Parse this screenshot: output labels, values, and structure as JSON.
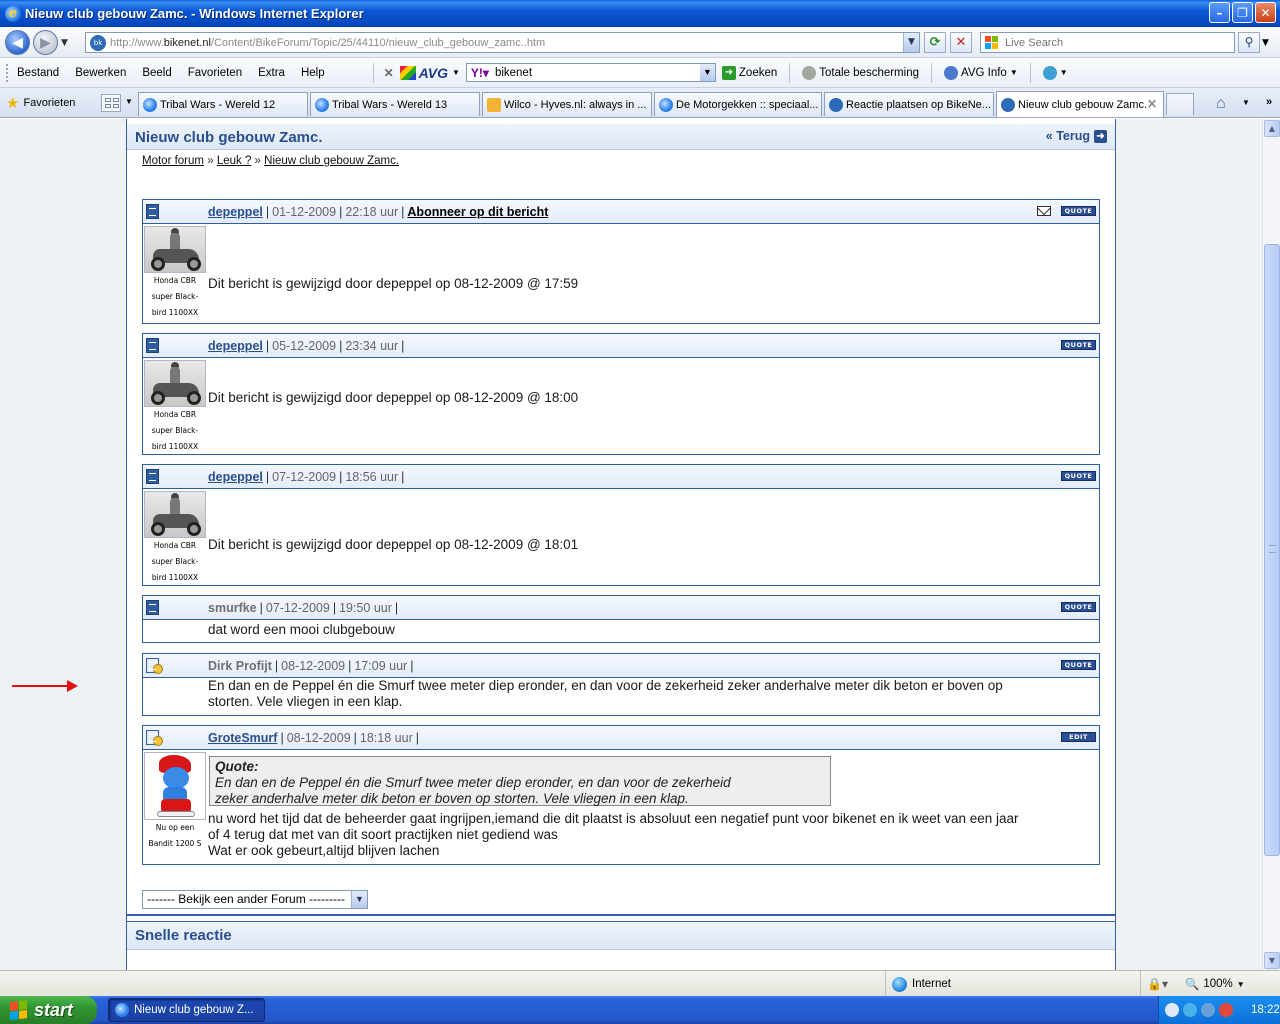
{
  "window": {
    "title": "Nieuw club gebouw Zamc. - Windows Internet Explorer"
  },
  "address": {
    "url_prefix": "http://www.",
    "url_host": "bikenet.nl",
    "url_path": "/Content/BikeForum/Topic/25/44110/nieuw_club_gebouw_zamc..htm",
    "search_placeholder": "Live Search"
  },
  "menu": {
    "items": [
      "Bestand",
      "Bewerken",
      "Beeld",
      "Favorieten",
      "Extra",
      "Help"
    ],
    "avg_label": "AVG",
    "yahoo_value": "bikenet",
    "zoeken": "Zoeken",
    "totale": "Totale bescherming",
    "avginfo": "AVG Info"
  },
  "tabs": {
    "favorites_label": "Favorieten",
    "items": [
      {
        "label": "Tribal Wars - Wereld 12"
      },
      {
        "label": "Tribal Wars - Wereld 13"
      },
      {
        "label": "Wilco - Hyves.nl: always in ..."
      },
      {
        "label": "De Motorgekken :: speciaal..."
      },
      {
        "label": "Reactie plaatsen op BikeNe..."
      },
      {
        "label": "Nieuw club gebouw Zamc."
      }
    ]
  },
  "page": {
    "title": "Nieuw club gebouw Zamc.",
    "back_label": "« Terug",
    "breadcrumb": [
      "Motor forum",
      "Leuk ?",
      "Nieuw club gebouw Zamc."
    ],
    "breadcrumb_sep": "»",
    "quote_label": "QUOTE",
    "edit_label": "EDIT",
    "avatar_caption_1": [
      "Honda CBR",
      "super Black-",
      "bird 1100XX"
    ],
    "avatar_caption_2": [
      "Nu op een",
      "Bandit 1200 S"
    ],
    "posts": [
      {
        "author": "depeppel",
        "date": "01-12-2009",
        "time": "22:18 uur",
        "extra": "Abonneer op dit bericht",
        "text": "Dit bericht is gewijzigd door depeppel op 08-12-2009 @ 17:59"
      },
      {
        "author": "depeppel",
        "date": "05-12-2009",
        "time": "23:34 uur",
        "text": "Dit bericht is gewijzigd door depeppel op 08-12-2009 @ 18:00"
      },
      {
        "author": "depeppel",
        "date": "07-12-2009",
        "time": "18:56 uur",
        "text": "Dit bericht is gewijzigd door depeppel op 08-12-2009 @ 18:01"
      },
      {
        "author": "smurfke",
        "date": "07-12-2009",
        "time": "19:50 uur",
        "text": "dat word een mooi clubgebouw"
      },
      {
        "author": "Dirk Profijt",
        "date": "08-12-2009",
        "time": "17:09 uur",
        "text_1": "En dan en de Peppel én die Smurf twee meter diep eronder, en dan voor de zekerheid zeker anderhalve meter dik beton er boven op",
        "text_2": "storten. Vele vliegen in een klap."
      },
      {
        "author": "GroteSmurf",
        "date": "08-12-2009",
        "time": "18:18 uur",
        "quote_head": "Quote:",
        "quote_1": "En dan en de Peppel én die Smurf twee meter diep eronder, en dan voor de zekerheid",
        "quote_2": "zeker anderhalve meter dik beton er boven op storten. Vele vliegen in een klap.",
        "text_1": "nu word het tijd dat de beheerder gaat ingrijpen,iemand die dit plaatst is absoluut een negatief punt voor bikenet en ik weet van een jaar",
        "text_2": "of 4 terug dat met van dit soort practijken niet gediend was",
        "text_3": "Wat er ook gebeurt,altijd blijven lachen"
      }
    ],
    "forum_select": "------- Bekijk een ander Forum ---------",
    "quick_reply_title": "Snelle reactie"
  },
  "status": {
    "zone": "Internet",
    "zoom": "100%"
  },
  "taskbar": {
    "start": "start",
    "item": "Nieuw club gebouw Z...",
    "clock": "18:22"
  }
}
